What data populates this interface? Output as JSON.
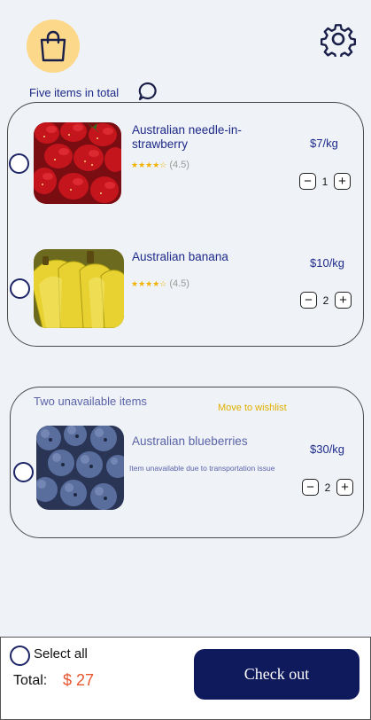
{
  "header": {
    "cart_icon": "shopping-bag-icon",
    "settings_icon": "gear-icon",
    "items_count_label": "Five items in total",
    "chat_icon": "chat-bubble-icon",
    "accent_color": "#fcd98a"
  },
  "available": {
    "items": [
      {
        "name": "Australian needle-in-strawberry",
        "price": "$7/kg",
        "rating_text": "(4.5)",
        "rating_value": 4.5,
        "quantity": "1",
        "image": "strawberries"
      },
      {
        "name": "Australian banana",
        "price": "$10/kg",
        "rating_text": "(4.5)",
        "rating_value": 4.5,
        "quantity": "2",
        "image": "bananas"
      }
    ]
  },
  "unavailable": {
    "title": "Two unavailable items",
    "wishlist_label": "Move to wishlist",
    "items": [
      {
        "name": "Australian blueberries",
        "price": "$30/kg",
        "note": "Item unavailable due to transportation issue",
        "quantity": "2",
        "image": "blueberries"
      }
    ]
  },
  "footer": {
    "select_all_label": "Select all",
    "total_label": "Total:",
    "total_value": "$ 27",
    "checkout_label": "Check out",
    "checkout_color": "#0f1a5c",
    "total_color": "#e8552e"
  }
}
